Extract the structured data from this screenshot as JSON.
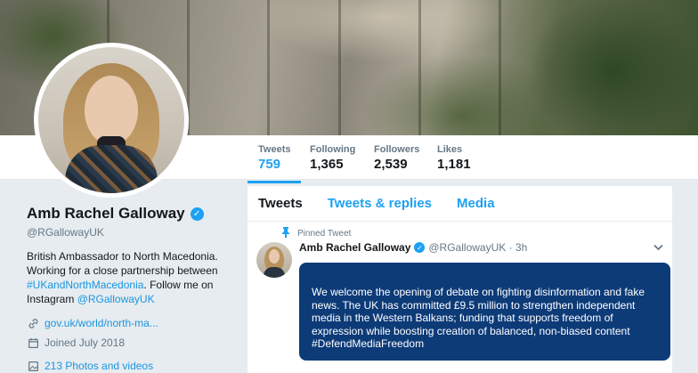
{
  "profile": {
    "name": "Amb Rachel Galloway",
    "handle": "@RGallowayUK",
    "bio_line1": "British Ambassador to North Macedonia.",
    "bio_line2": "Working for a close partnership between",
    "bio_link1": "#UKandNorthMacedonia",
    "bio_line3": ". Follow me on",
    "bio_line4": "Instagram ",
    "bio_link2": "@RGallowayUK",
    "website": "gov.uk/world/north-ma...",
    "joined": "Joined July 2018",
    "photos": "213 Photos and videos"
  },
  "stats": [
    {
      "label": "Tweets",
      "value": "759"
    },
    {
      "label": "Following",
      "value": "1,365"
    },
    {
      "label": "Followers",
      "value": "2,539"
    },
    {
      "label": "Likes",
      "value": "1,181"
    }
  ],
  "tabs": [
    "Tweets",
    "Tweets & replies",
    "Media"
  ],
  "tweet": {
    "pinned_label": "Pinned Tweet",
    "author": "Amb Rachel Galloway",
    "handle_time": "@RGallowayUK · 3h",
    "text": "We welcome the opening of debate on fighting disinformation and fake news. The UK has committed £9.5 million to strengthen independent media in the Western Balkans; funding that supports freedom of expression while boosting creation of balanced, non-biased content #DefendMediaFreedom"
  },
  "icons": {
    "verified": "verified-badge-icon",
    "link": "link-icon",
    "calendar": "calendar-icon",
    "photos": "photos-icon",
    "pin": "pin-icon",
    "caret": "chevron-down-icon"
  },
  "colors": {
    "accent": "#1da1f2",
    "tweet_card": "#0d3b78",
    "background": "#e6ecf0"
  }
}
